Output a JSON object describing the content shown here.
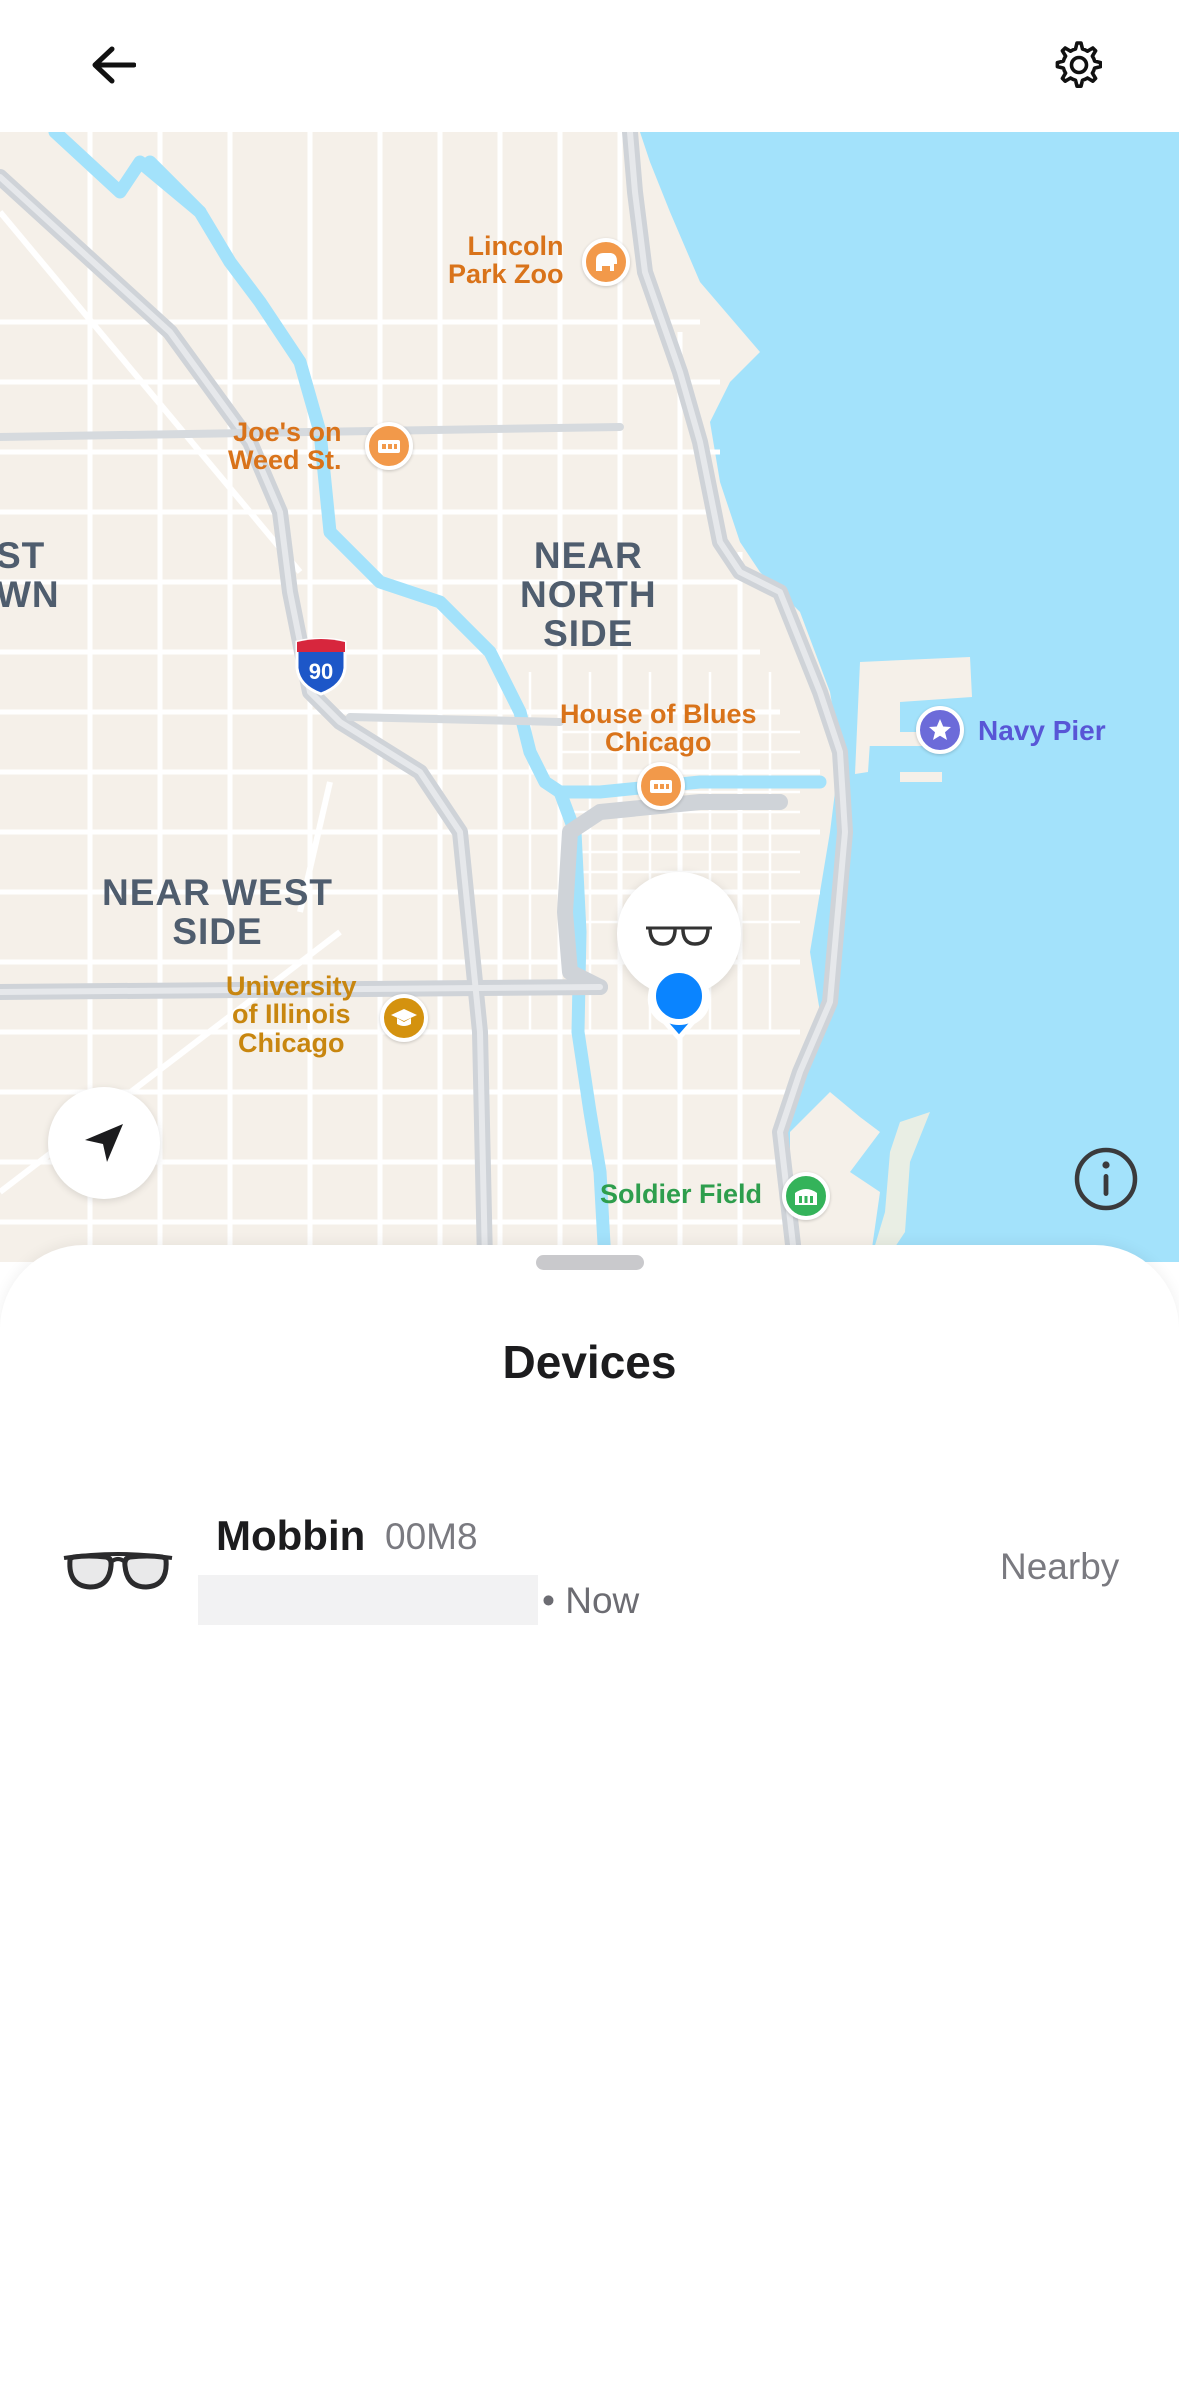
{
  "header": {
    "back_icon": "arrow-left-icon",
    "settings_icon": "gear-icon"
  },
  "map": {
    "neighborhoods": [
      {
        "name": "NEAR\nNORTH\nSIDE"
      },
      {
        "name": "NEAR WEST\nSIDE"
      },
      {
        "name": "ST\nWN"
      }
    ],
    "pois": [
      {
        "name": "Lincoln\nPark Zoo",
        "icon": "zoo-icon",
        "color": "#f2994a"
      },
      {
        "name": "Joe's on\nWeed St.",
        "icon": "music-venue-icon",
        "color": "#f2994a"
      },
      {
        "name": "House of Blues\nChicago",
        "icon": "music-venue-icon",
        "color": "#f2994a"
      },
      {
        "name": "University\nof Illinois\nChicago",
        "icon": "graduation-cap-icon",
        "color": "#d4920f"
      },
      {
        "name": "Navy Pier",
        "icon": "star-icon",
        "color": "#6c6bd9"
      },
      {
        "name": "Soldier Field",
        "icon": "stadium-icon",
        "color": "#34b35a"
      }
    ],
    "highway_shield": "90",
    "water_color": "#a3e2fb",
    "land_color": "#f5f0e9"
  },
  "sheet": {
    "title": "Devices"
  },
  "devices": [
    {
      "name": "Mobbin",
      "model": "00M8",
      "time": "• Now",
      "status": "Nearby",
      "icon": "glasses-icon"
    }
  ]
}
